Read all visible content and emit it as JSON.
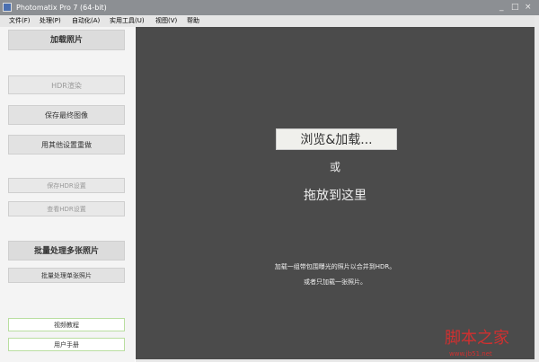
{
  "window": {
    "title": "Photomatix Pro 7  (64-bit)",
    "min": "_",
    "max": "□",
    "close": "×"
  },
  "menu": [
    "文件(F)",
    "处理(P)",
    "自动化(A)",
    "实用工具(U)",
    "视图(V)",
    "帮助"
  ],
  "sidebar": {
    "load": "加载照片",
    "hdr_render": "HDR渲染",
    "save_final": "保存最终图像",
    "redo": "用其他设置重做",
    "save_hdr": "保存HDR设置",
    "view_hdr": "查看HDR设置",
    "batch_multi": "批量处理多张照片",
    "batch_single": "批量处理单张照片",
    "video": "视频教程",
    "manual": "用户手册"
  },
  "main": {
    "browse": "浏览&加载...",
    "or": "或",
    "drop": "拖放到这里",
    "hint1": "加载一组带包围曝光的照片以合并到HDR。",
    "hint2": "或者只加载一张照片。"
  },
  "watermark": {
    "text": "脚本之家",
    "url": "www.jb51.net"
  }
}
